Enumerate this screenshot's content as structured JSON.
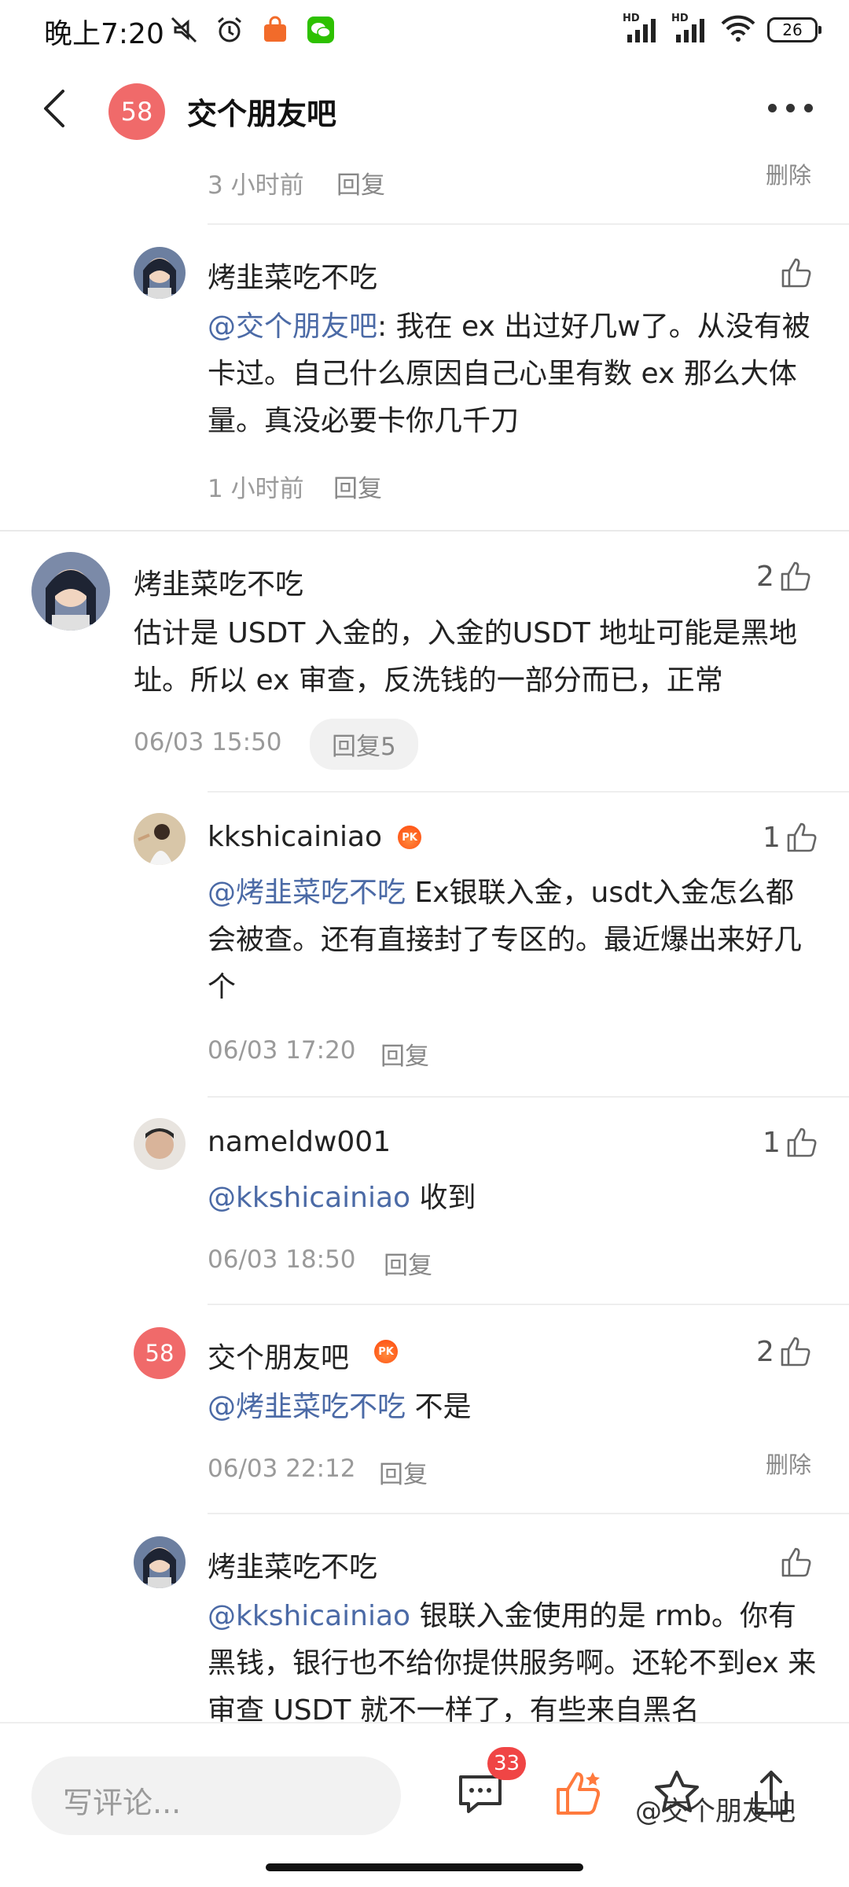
{
  "status_bar": {
    "time": "晚上7:20",
    "battery": "26",
    "signal1": "HD",
    "signal2": "HD"
  },
  "header": {
    "avatar_text": "58",
    "title": "交个朋友吧"
  },
  "comments": {
    "top_partial": {
      "time": "3 小时前",
      "reply": "回复",
      "delete": "删除"
    },
    "reply_a": {
      "name": "烤韭菜吃不吃",
      "mention": "@交个朋友吧",
      "text": ": 我在 ex 出过好几w了。从没有被卡过。自己什么原因自己心里有数 ex 那么大体量。真没必要卡你几千刀",
      "time": "1 小时前",
      "reply": "回复"
    },
    "main": {
      "name": "烤韭菜吃不吃",
      "likes": "2",
      "text": "估计是 USDT 入金的，入金的USDT 地址可能是黑地址。所以 ex 审查，反洗钱的一部分而已，正常",
      "time": "06/03 15:50",
      "reply_pill": "回复5"
    },
    "reply_b": {
      "name": "kkshicainiao",
      "pk": "PK",
      "likes": "1",
      "mention": "@烤韭菜吃不吃",
      "text": " Ex银联入金，usdt入金怎么都会被查。还有直接封了专区的。最近爆出来好几个",
      "time": "06/03 17:20",
      "reply": "回复"
    },
    "reply_c": {
      "name": "nameldw001",
      "likes": "1",
      "mention": "@kkshicainiao",
      "text": " 收到",
      "time": "06/03 18:50",
      "reply": "回复"
    },
    "reply_d": {
      "avatar_text": "58",
      "name": "交个朋友吧",
      "pk": "PK",
      "likes": "2",
      "mention": "@烤韭菜吃不吃",
      "text": " 不是",
      "time": "06/03 22:12",
      "reply": "回复",
      "delete": "删除"
    },
    "reply_e": {
      "name": "烤韭菜吃不吃",
      "mention": "@kkshicainiao",
      "text": " 银联入金使用的是 rmb。你有黑钱，银行也不给你提供服务啊。还轮不到ex 来审查 USDT 就不一样了，有些来自黑名"
    }
  },
  "bottom_bar": {
    "placeholder": "写评论...",
    "comment_count": "33",
    "watermark": "@交个朋友吧"
  },
  "colors": {
    "accent_red": "#f06a6a",
    "mention_blue": "#4b6aa6",
    "like_orange": "#ff7a3d"
  }
}
